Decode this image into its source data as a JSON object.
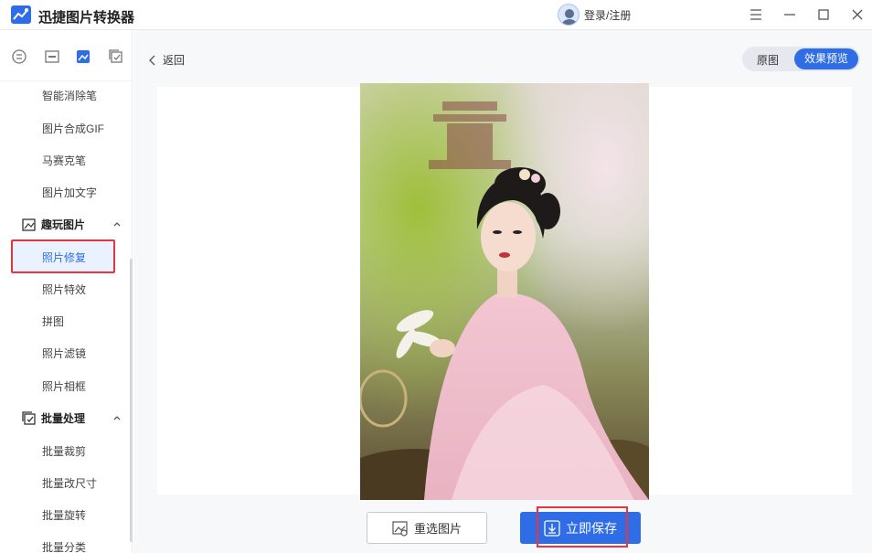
{
  "app": {
    "title": "迅捷图片转换器"
  },
  "header": {
    "login_text": "登录/注册"
  },
  "window_controls": {
    "menu_icon": "menu-icon",
    "minimize_icon": "minimize-icon",
    "maximize_icon": "maximize-icon",
    "close_icon": "close-icon"
  },
  "sidebar": {
    "top_icons": [
      "convert-icon",
      "crop-icon",
      "image-icon",
      "batch-check-icon"
    ],
    "items_before": [
      "智能消除笔",
      "图片合成GIF",
      "马赛克笔",
      "图片加文字"
    ],
    "group_fun": {
      "label": "趣玩图片",
      "icon": "fun-image-icon"
    },
    "active_item": "照片修复",
    "fun_items": [
      "照片特效",
      "拼图",
      "照片滤镜",
      "照片相框"
    ],
    "group_batch": {
      "label": "批量处理",
      "icon": "batch-icon"
    },
    "batch_items": [
      "批量裁剪",
      "批量改尺寸",
      "批量旋转",
      "批量分类"
    ]
  },
  "main": {
    "back_label": "返回",
    "toggle_original": "原图",
    "toggle_effect": "效果预览",
    "reselect_label": "重选图片",
    "save_label": "立即保存"
  },
  "colors": {
    "accent": "#2e6de6",
    "highlight": "#e8343a",
    "active_bg": "#eaf2ff"
  }
}
